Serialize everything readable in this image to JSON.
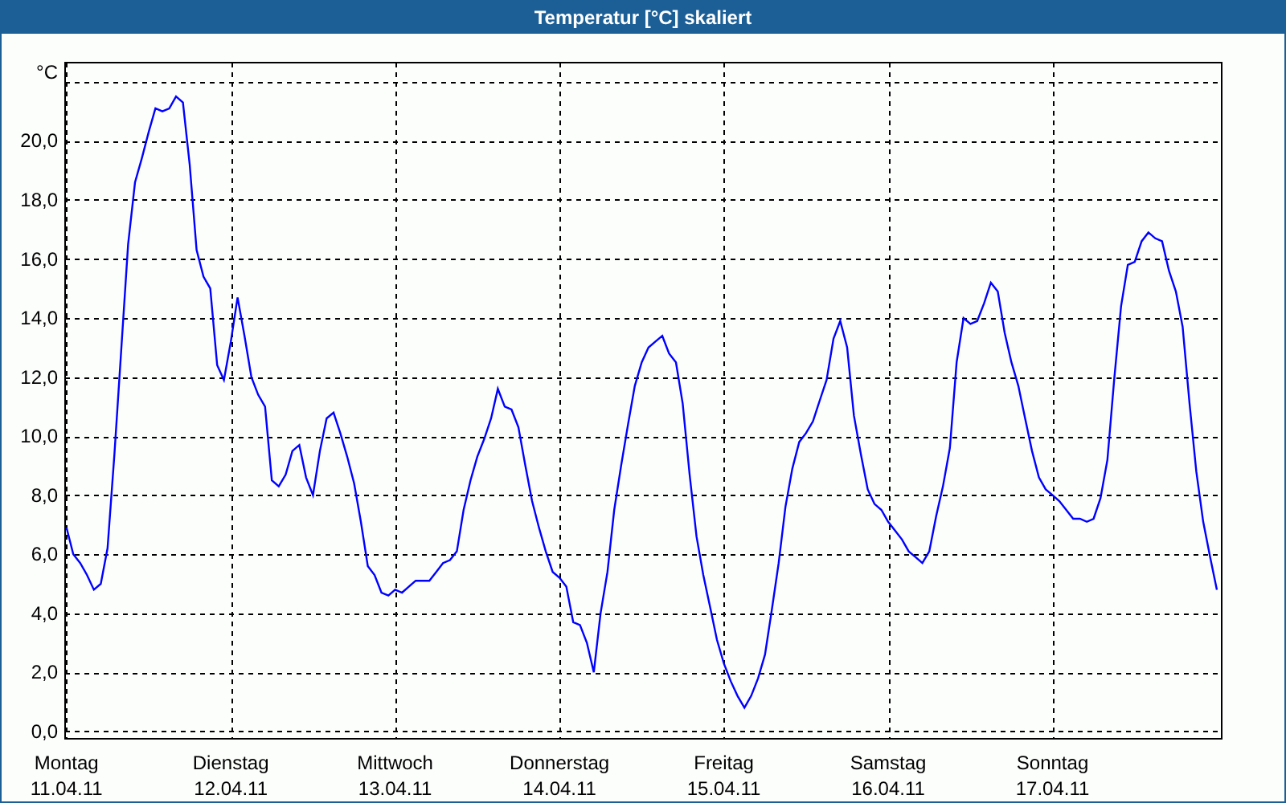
{
  "window": {
    "title": "Temperatur [°C] skaliert"
  },
  "chart_data": {
    "type": "line",
    "ylabel": "°C",
    "grid": true,
    "ylim": [
      -0.25,
      22.65
    ],
    "categories": [
      "Montag\n11.04.11",
      null,
      null,
      null,
      null,
      null,
      null,
      null,
      null,
      null,
      null,
      null,
      null,
      null,
      null,
      null,
      null,
      null,
      null,
      null,
      null,
      null,
      null,
      null,
      "Dienstag\n12.04.11",
      null,
      null,
      null,
      null,
      null,
      null,
      null,
      null,
      null,
      null,
      null,
      null,
      null,
      null,
      null,
      null,
      null,
      null,
      null,
      null,
      null,
      null,
      null,
      "Mittwoch\n13.04.11",
      null,
      null,
      null,
      null,
      null,
      null,
      null,
      null,
      null,
      null,
      null,
      null,
      null,
      null,
      null,
      null,
      null,
      null,
      null,
      null,
      null,
      null,
      null,
      "Donnerstag\n14.04.11",
      null,
      null,
      null,
      null,
      null,
      null,
      null,
      null,
      null,
      null,
      null,
      null,
      null,
      null,
      null,
      null,
      null,
      null,
      null,
      null,
      null,
      null,
      null,
      "Freitag\n15.04.11",
      null,
      null,
      null,
      null,
      null,
      null,
      null,
      null,
      null,
      null,
      null,
      null,
      null,
      null,
      null,
      null,
      null,
      null,
      null,
      null,
      null,
      null,
      null,
      "Samstag\n16.04.11",
      null,
      null,
      null,
      null,
      null,
      null,
      null,
      null,
      null,
      null,
      null,
      null,
      null,
      null,
      null,
      null,
      null,
      null,
      null,
      null,
      null,
      null,
      null,
      "Sonntag\n17.04.11",
      null,
      null,
      null,
      null,
      null,
      null,
      null,
      null,
      null,
      null,
      null,
      null,
      null,
      null,
      null,
      null,
      null,
      null,
      null,
      null,
      null,
      null,
      null,
      null
    ],
    "yticks": [
      {
        "value": 0,
        "label": "0,0"
      },
      {
        "value": 2,
        "label": "2,0"
      },
      {
        "value": 4,
        "label": "4,0"
      },
      {
        "value": 6,
        "label": "6,0"
      },
      {
        "value": 8,
        "label": "8,0"
      },
      {
        "value": 10,
        "label": "10,0"
      },
      {
        "value": 12,
        "label": "12,0"
      },
      {
        "value": 14,
        "label": "14,0"
      },
      {
        "value": 16,
        "label": "16,0"
      },
      {
        "value": 18,
        "label": "18,0"
      },
      {
        "value": 20,
        "label": "20,0"
      }
    ],
    "series": [
      {
        "color": "#0000ff",
        "values": [
          6.9,
          6.0,
          5.7,
          5.3,
          4.8,
          5.0,
          6.2,
          9.4,
          12.9,
          16.5,
          18.6,
          19.4,
          20.3,
          21.1,
          21.0,
          21.1,
          21.5,
          21.3,
          19.2,
          16.3,
          15.4,
          15.0,
          12.4,
          11.9,
          13.2,
          14.7,
          13.4,
          12.0,
          11.4,
          11.0,
          8.5,
          8.3,
          8.7,
          9.5,
          9.7,
          8.6,
          8.0,
          9.5,
          10.6,
          10.8,
          10.1,
          9.3,
          8.4,
          7.1,
          5.6,
          5.3,
          4.7,
          4.6,
          4.8,
          4.7,
          4.9,
          5.1,
          5.1,
          5.1,
          5.4,
          5.7,
          5.8,
          6.1,
          7.5,
          8.5,
          9.3,
          9.9,
          10.6,
          11.6,
          11.0,
          10.9,
          10.3,
          9.0,
          7.8,
          6.9,
          6.1,
          5.4,
          5.2,
          4.9,
          3.7,
          3.6,
          3.0,
          2.0,
          4.0,
          5.4,
          7.5,
          9.0,
          10.4,
          11.7,
          12.5,
          13.0,
          13.2,
          13.4,
          12.8,
          12.5,
          11.1,
          8.7,
          6.6,
          5.3,
          4.2,
          3.1,
          2.3,
          1.7,
          1.2,
          0.8,
          1.2,
          1.8,
          2.6,
          4.1,
          5.7,
          7.6,
          8.9,
          9.8,
          10.1,
          10.5,
          11.2,
          11.9,
          13.3,
          13.9,
          13.0,
          10.7,
          9.4,
          8.2,
          7.7,
          7.5,
          7.1,
          6.8,
          6.5,
          6.1,
          5.9,
          5.7,
          6.1,
          7.3,
          8.3,
          9.6,
          12.5,
          14.0,
          13.8,
          13.9,
          14.5,
          15.2,
          14.9,
          13.5,
          12.5,
          11.7,
          10.6,
          9.5,
          8.6,
          8.2,
          8.0,
          7.8,
          7.5,
          7.2,
          7.2,
          7.1,
          7.2,
          7.9,
          9.2,
          11.9,
          14.4,
          15.8,
          15.9,
          16.6,
          16.9,
          16.7,
          16.6,
          15.6,
          14.9,
          13.7,
          11.1,
          8.8,
          7.1,
          5.9,
          4.8
        ]
      }
    ]
  }
}
